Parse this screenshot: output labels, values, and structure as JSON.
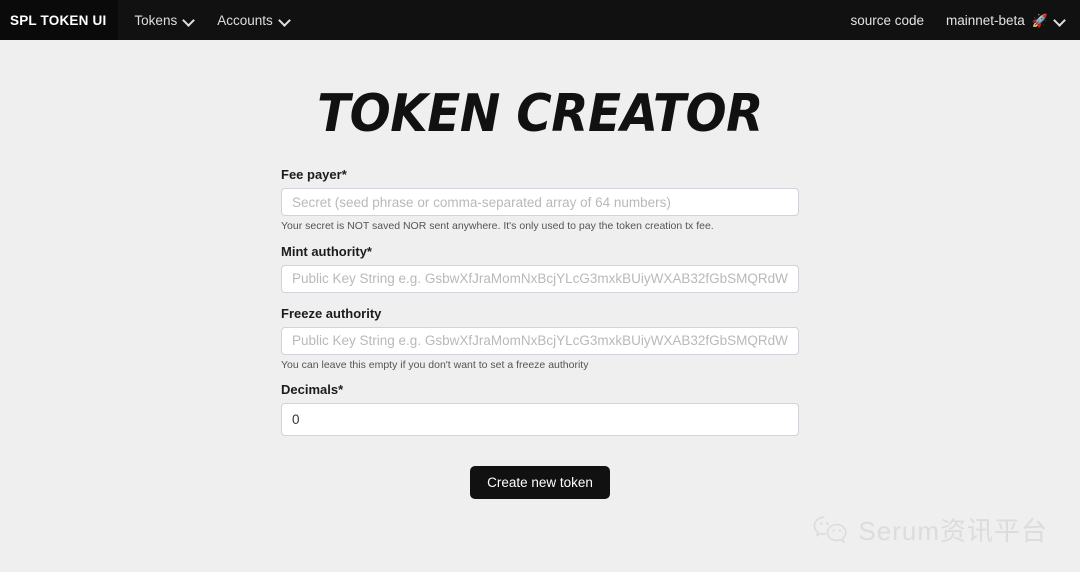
{
  "navbar": {
    "brand": "SPL TOKEN UI",
    "links": [
      {
        "label": "Tokens",
        "icon": "chevron-down-icon"
      },
      {
        "label": "Accounts",
        "icon": "chevron-down-icon"
      }
    ],
    "right": {
      "source_code": "source code",
      "network": "mainnet-beta",
      "network_emoji": "🚀",
      "network_icon": "chevron-down-icon"
    },
    "background_color": "#111111",
    "brand_background_color": "#0a0a0a"
  },
  "page": {
    "title": "TOKEN CREATOR",
    "background_color": "#efefef"
  },
  "form": {
    "fee_payer": {
      "label": "Fee payer*",
      "value": "",
      "placeholder": "Secret (seed phrase or comma-separated array of 64 numbers)",
      "help": "Your secret is NOT saved NOR sent anywhere. It's only used to pay the token creation tx fee."
    },
    "mint_authority": {
      "label": "Mint authority*",
      "value": "",
      "placeholder": "Public Key String e.g. GsbwXfJraMomNxBcjYLcG3mxkBUiyWXAB32fGbSMQRdW"
    },
    "freeze_authority": {
      "label": "Freeze authority",
      "value": "",
      "placeholder": "Public Key String e.g. GsbwXfJraMomNxBcjYLcG3mxkBUiyWXAB32fGbSMQRdW",
      "help": "You can leave this empty if you don't want to set a freeze authority"
    },
    "decimals": {
      "label": "Decimals*",
      "value": "0",
      "placeholder": ""
    },
    "submit_label": "Create new token",
    "submit_color": "#111111"
  },
  "watermark": {
    "icon": "wechat-icon",
    "text": "Serum资讯平台",
    "color": "#dcdcdc"
  }
}
